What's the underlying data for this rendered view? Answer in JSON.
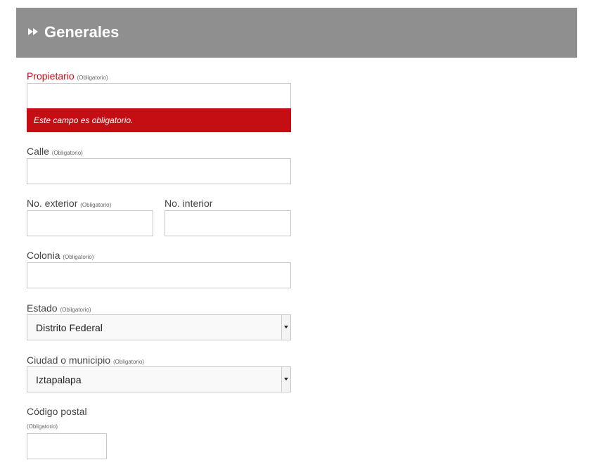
{
  "header": {
    "title": "Generales",
    "icon": "double-arrow-icon"
  },
  "required_text": "(Obligatorio)",
  "fields": {
    "propietario": {
      "label": "Propietario",
      "value": "",
      "error": "Este campo es obligatorio."
    },
    "calle": {
      "label": "Calle",
      "value": ""
    },
    "no_exterior": {
      "label": "No. exterior",
      "value": ""
    },
    "no_interior": {
      "label": "No. interior",
      "value": ""
    },
    "colonia": {
      "label": "Colonia",
      "value": ""
    },
    "estado": {
      "label": "Estado",
      "selected": "Distrito Federal"
    },
    "ciudad": {
      "label": "Ciudad o municipio",
      "selected": "Iztapalapa"
    },
    "codigo_postal": {
      "label": "Código postal",
      "value": ""
    }
  },
  "colors": {
    "header_bg": "#8f8f8f",
    "error_red": "#c40e13"
  }
}
